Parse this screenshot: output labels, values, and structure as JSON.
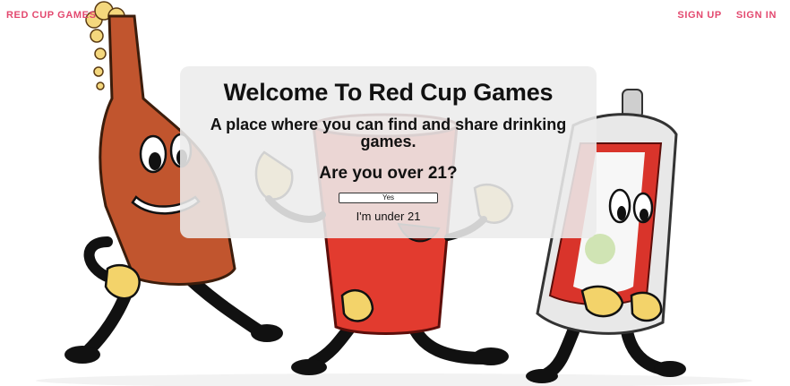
{
  "nav": {
    "brand": "RED CUP GAMES",
    "links": [
      {
        "label": "SIGN UP"
      },
      {
        "label": "SIGN IN"
      }
    ]
  },
  "modal": {
    "title": "Welcome To Red Cup Games",
    "subtitle": "A place where you can find and share drinking games.",
    "question": "Are you over 21?",
    "yes_label": "Yes",
    "under_label": "I'm under 21"
  },
  "colors": {
    "brand": "#e3496f",
    "bottle": "#c1552e",
    "cup": "#e23b2f",
    "can_red": "#d9342b",
    "glove": "#f3d36a"
  },
  "illustration": {
    "characters": [
      "bottle-character",
      "red-cup-character",
      "beer-can-character"
    ]
  }
}
